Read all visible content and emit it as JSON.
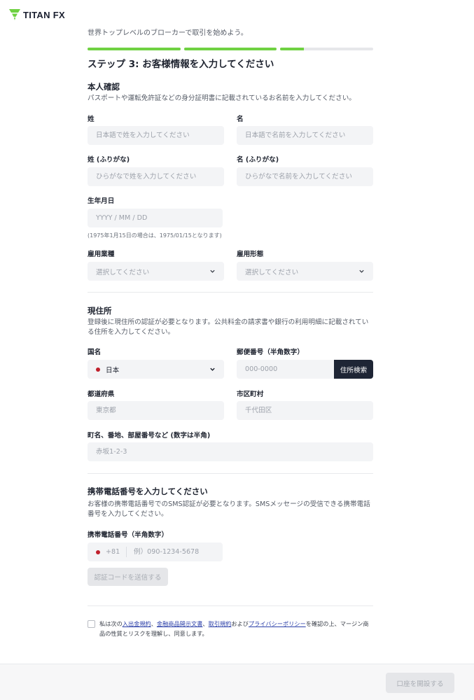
{
  "brand": {
    "name": "TITAN FX",
    "accent": "#6fd142"
  },
  "subtitle": "世界トップレベルのブローカーで取引を始めよう。",
  "progress": {
    "steps_total": 3,
    "segments": [
      1.0,
      1.0,
      0.25
    ]
  },
  "step_title": "ステップ 3: お客様情報を入力してください",
  "identity": {
    "title": "本人確認",
    "description": "パスポートや運転免許証などの身分証明書に記載されているお名前を入力してください。",
    "last_name_label": "姓",
    "last_name_placeholder": "日本語で姓を入力してください",
    "first_name_label": "名",
    "first_name_placeholder": "日本語で名前を入力してください",
    "last_name_kana_label": "姓 (ふりがな)",
    "last_name_kana_placeholder": "ひらがなで姓を入力してください",
    "first_name_kana_label": "名 (ふりがな)",
    "first_name_kana_placeholder": "ひらがなで名前を入力してください",
    "birthdate_label": "生年月日",
    "birthdate_placeholder": "YYYY / MM / DD",
    "birthdate_hint": "(1975年1月15日の場合は、1975/01/15となります)",
    "occupation_label": "雇用業種",
    "occupation_value": "選択してください",
    "employment_label": "雇用形態",
    "employment_value": "選択してください"
  },
  "address": {
    "title": "現住所",
    "description": "登録後に現住所の認証が必要となります。公共料金の請求書や銀行の利用明細に記載されている住所を入力してください。",
    "country_label": "国名",
    "country_value": "日本",
    "postal_label": "郵便番号（半角数字）",
    "postal_placeholder": "000-0000",
    "postal_search_button": "住所検索",
    "prefecture_label": "都道府県",
    "prefecture_placeholder": "東京都",
    "city_label": "市区町村",
    "city_placeholder": "千代田区",
    "street_label": "町名、番地、部屋番号など (数字は半角)",
    "street_placeholder": "赤坂1-2-3"
  },
  "phone": {
    "title": "携帯電話番号を入力してください",
    "description": "お客様の携帯電話番号でのSMS認証が必要となります。SMSメッセージの受信できる携帯電話番号を入力してください。",
    "label": "携帯電話番号（半角数字）",
    "country_code": "+81",
    "placeholder": "例）090-1234-5678",
    "send_code_button": "認証コードを送信する"
  },
  "consent": {
    "prefix": "私は次の",
    "link1": "入出金規約",
    "sep1": "、",
    "link2": "金融商品開示文書",
    "sep2": "、",
    "link3": "取引規約",
    "sep3": "および",
    "link4": "プライバシーポリシー",
    "suffix": "を確認の上、マージン商品の性質とリスクを理解し、同意します。"
  },
  "footer": {
    "submit_button": "口座を開設する"
  }
}
